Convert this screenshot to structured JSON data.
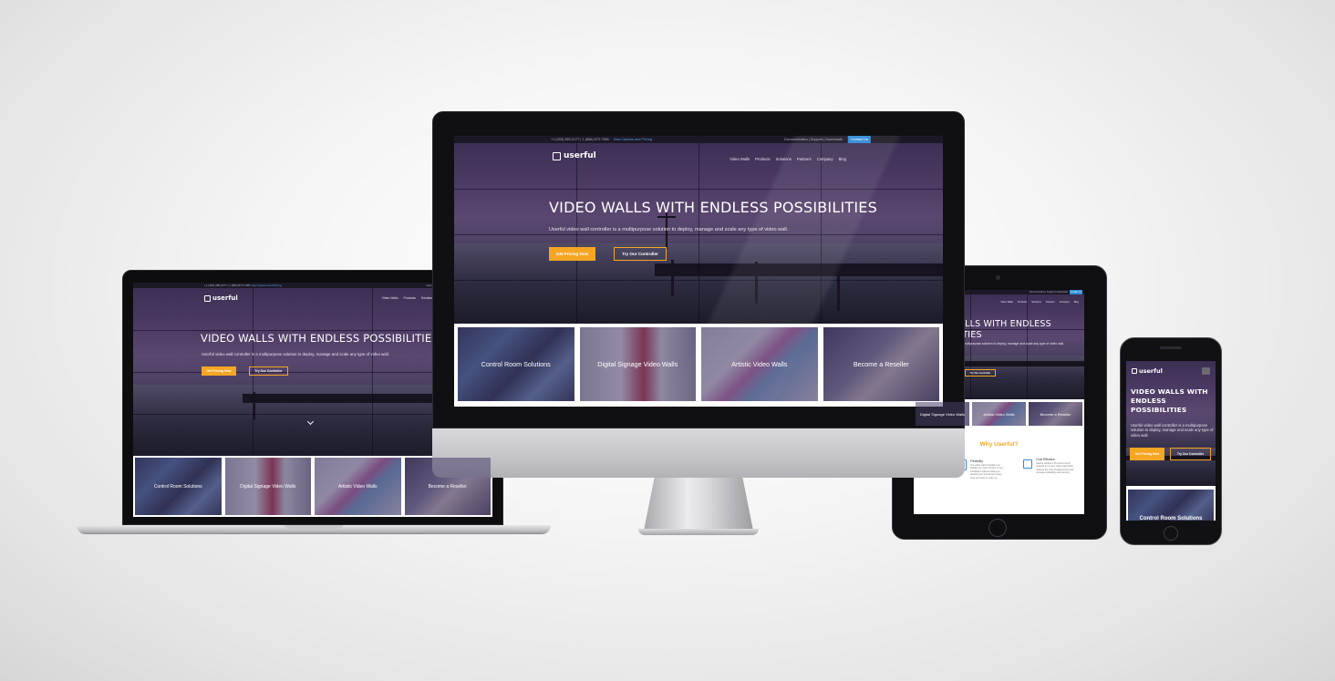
{
  "site": {
    "top_phone": "+1 (403) 289-2177 | 1 (866) 873-7385",
    "top_highlight": "View Options and Pricing",
    "top_links": "Documentation | Support | Downloads",
    "contact_label": "Contact Us",
    "logo_text": "userful",
    "nav": [
      "Video Walls",
      "Products",
      "Solutions",
      "Partners",
      "Company",
      "Blog"
    ],
    "hero_title": "VIDEO WALLS WITH ENDLESS POSSIBILITIES",
    "hero_title_mobile": "VIDEO WALLS WITH ENDLESS POSSIBILITIES",
    "hero_subtitle": "Userful video wall controller is a multipurpose solution to deploy, manage and scale any type of video wall.",
    "btn_pricing": "Get Pricing Now",
    "btn_try": "Try Our Controller",
    "scroll_icon": "chevron-down-icon",
    "cards": [
      "Control Room Solutions",
      "Digital Signage Video Walls",
      "Artistic Video Walls",
      "Become a Reseller"
    ],
    "why_title": "Why Userful?",
    "features": [
      {
        "title": "Flexibility",
        "text": "Our video wall controller can handle any input content to any installation without having to replace your investment every time you want to scale up."
      },
      {
        "title": "Cost Effective",
        "text": "Userful utilizes a PC and a cloud network to run any video wall which reduces the cost of deployment and increases reliability and security."
      }
    ],
    "colors": {
      "accent": "#f5a623",
      "dark": "#1c1825",
      "hero": "#4b3a63"
    }
  }
}
